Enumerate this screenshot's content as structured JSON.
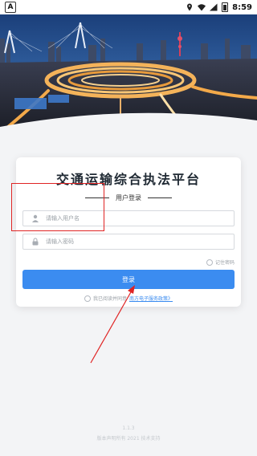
{
  "statusbar": {
    "app_badge": "A",
    "time": "8:59"
  },
  "card": {
    "title": "交通运输综合执法平台",
    "subtitle": "用户登录",
    "username": {
      "placeholder": "请输入用户名",
      "value": ""
    },
    "password": {
      "placeholder": "请输入密码",
      "value": ""
    },
    "remember_label": "记住密码",
    "login_label": "登录",
    "agree_text": "我已阅读并同意",
    "agree_link": "南方电子服务政策》"
  },
  "footer": {
    "version": "1.1.3",
    "copyright": "版本声明所有 2021 技术支持"
  },
  "colors": {
    "primary": "#3b8cf0",
    "highlight": "#e02424"
  },
  "icons": [
    "location-icon",
    "wifi-icon",
    "signal-icon",
    "battery-icon",
    "user-icon",
    "lock-icon"
  ]
}
